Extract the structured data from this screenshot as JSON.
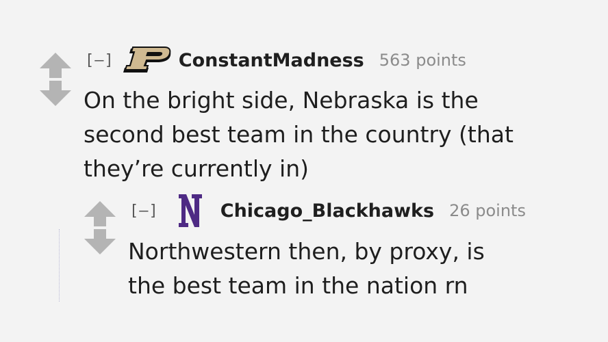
{
  "comments": [
    {
      "collapse_label": "[–]",
      "author": "ConstantMadness",
      "score": "563 points",
      "flair_icon": "purdue-p-logo-icon",
      "body_lines": [
        "On the bright side, Nebraska is the",
        "second best team in the country (that",
        "they’re currently in)"
      ]
    },
    {
      "collapse_label": "[–]",
      "author": "Chicago_Blackhawks",
      "score": "26 points",
      "flair_icon": "northwestern-n-logo-icon",
      "body_lines": [
        "Northwestern then, by proxy, is",
        "the best team in the nation rn"
      ]
    }
  ],
  "colors": {
    "background": "#f3f3f3",
    "arrow": "#b4b4b4",
    "purdue_gold": "#cfb991",
    "northwestern_purple": "#4e2a84",
    "score": "#8b8b8b"
  }
}
